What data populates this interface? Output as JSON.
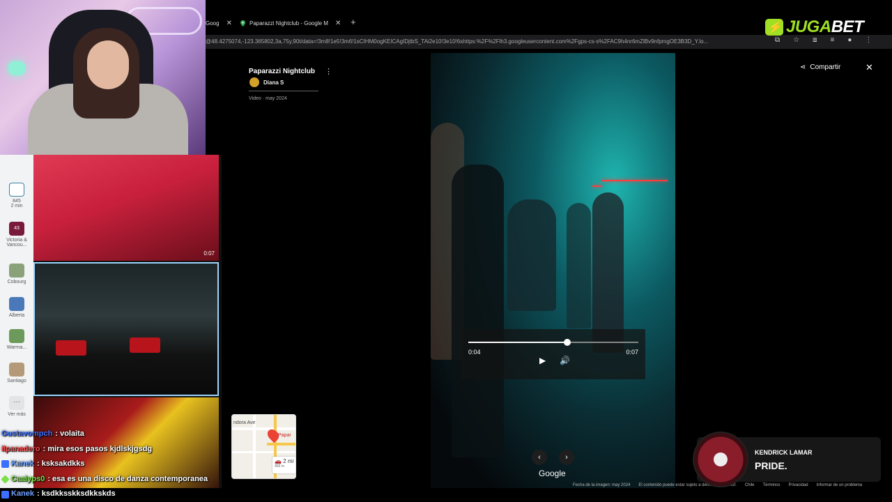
{
  "browser": {
    "tabs": [
      {
        "label": "Goog",
        "active": false
      },
      {
        "label": "Paparazzi Nightclub - Google M",
        "active": true
      }
    ],
    "url": "@48.4275074,-123.365802,3a,75y,90t/data=!3m8!1e5!3m6!1sCIHM0ogKEICAgIDjtbS_TAi2e10!3e10!6shttps:%2F%2Flh3.googleusercontent.com%2Fgps-cs-s%2FAC9h4nr6mZlBv9nfpmgOE3B3D_Y.lo..."
  },
  "overlay": {
    "logo_juga": "JUGA",
    "logo_bet": "BET"
  },
  "rail": {
    "items": [
      {
        "label": "845",
        "sub": "2 min"
      },
      {
        "label": "Victoria &",
        "sub": "Vancou..."
      },
      {
        "label": "Cobourg",
        "sub": ""
      },
      {
        "label": "Alberta",
        "sub": ""
      },
      {
        "label": "Warrna...",
        "sub": ""
      },
      {
        "label": "Santiago",
        "sub": ""
      },
      {
        "label": "Ver más",
        "sub": ""
      }
    ],
    "badge": "43"
  },
  "strip": {
    "photos": [
      {
        "duration": "0:07"
      },
      {
        "duration": ""
      },
      {
        "duration": ""
      }
    ]
  },
  "viewer": {
    "place": "Paparazzi Nightclub",
    "author": "Diana S",
    "meta": "Video · may 2024",
    "share": "Compartir",
    "current_time": "0:04",
    "total_time": "0:07",
    "progress": 0.58,
    "google": "Google",
    "footer": [
      "Fecha de la imagen: may 2024",
      "El contenido puede estar sujeto a derechos de autor.",
      "Chile",
      "Términos",
      "Privacidad",
      "Informar de un problema"
    ]
  },
  "minimap": {
    "street": "ndora Ave",
    "label": "Papar",
    "drive": "2 mi",
    "distance": "400 m"
  },
  "chat": [
    {
      "user": "Gustavompch",
      "msg": ": volaita",
      "color": "#3b6fff"
    },
    {
      "user": "ilpanadero",
      "msg": ": mira esos pasos kjdlskjgsdg",
      "color": "#ff4b4b"
    },
    {
      "user": "Kanek",
      "msg": ": ksksakdkks",
      "color": "#6ea0ff"
    },
    {
      "user": "Caalyps0",
      "msg": ": esa es una disco de danza contemporanea",
      "color": "#7be04a"
    },
    {
      "user": "Kanek",
      "msg": ": ksdkksskksdkkskds",
      "color": "#6ea0ff"
    }
  ],
  "now_playing": {
    "artist": "KENDRICK LAMAR",
    "song": "PRIDE."
  }
}
